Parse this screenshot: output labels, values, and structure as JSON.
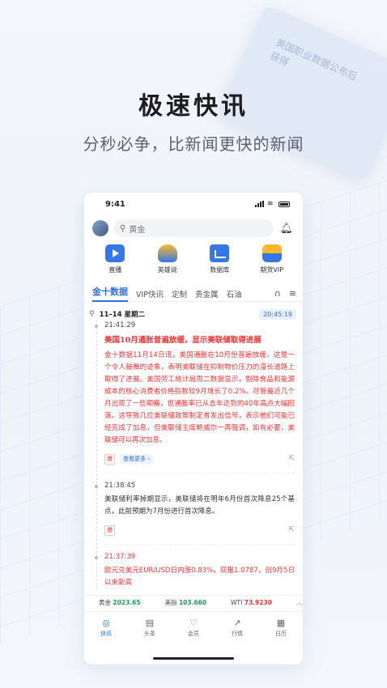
{
  "promo": {
    "title": "极速快讯",
    "subtitle": "分秒必争，比新闻更快的新闻",
    "bg_card_text": [
      "美国职业数据公布后",
      "获得"
    ]
  },
  "status": {
    "time": "9:41"
  },
  "search": {
    "placeholder": "黄金"
  },
  "quick": [
    {
      "label": "直播",
      "icon": "video-icon"
    },
    {
      "label": "英雄说",
      "icon": "hero-icon"
    },
    {
      "label": "数据库",
      "icon": "database-icon"
    },
    {
      "label": "期货VIP",
      "icon": "vip-icon"
    }
  ],
  "tabs": [
    "金十数据",
    "VIP快讯",
    "定制",
    "贵金属",
    "石油"
  ],
  "date": {
    "text": "11–14 星期二",
    "clock": "20:45:19"
  },
  "feed": [
    {
      "time": "21:41:29",
      "headline": "美国10月通胀普遍放缓，显示美联储取得进展",
      "body": "金十数据11月14日讯，美国通胀在10月份普遍放缓，这是一个令人鼓舞的迹象，表明美联储在抑制物价压力的漫长道路上取得了进展。美国劳工统计局周二数据显示，剔除食品和能源成本的核心消费者价格指数较9月增长了0.2%。尽管最近几个月出现了一些颠簸，但通胀率已从去年达到的40年高点大幅回落。这导致几位美联储政策制定者发出信号，表示他们可能已经完成了加息，但美联储主席鲍威尔一再强调，如有必要，美联储可以再次加息。",
      "tag": "爆",
      "more": "查看更多 ›"
    },
    {
      "time": "21:38:45",
      "body": "美联储利率掉期显示，美联储将在明年6月份首次降息25个基点，此前预期为7月份进行首次降息。",
      "tag": "爆"
    },
    {
      "time": "21:37:39",
      "body": "欧元兑美元EUR/USD日内涨0.83%，现报1.0787，创9月5日以来新高"
    }
  ],
  "ticker": [
    {
      "name": "黄金",
      "value": "2023.65",
      "color": "#18a058"
    },
    {
      "name": "美指",
      "value": "103.660",
      "color": "#18a058"
    },
    {
      "name": "WTI",
      "value": "73.9230",
      "color": "#e33"
    }
  ],
  "nav": [
    {
      "label": "快讯",
      "icon": "newsflash-icon",
      "glyph": "◎",
      "active": true
    },
    {
      "label": "头条",
      "icon": "headlines-icon",
      "glyph": "▤",
      "active": false
    },
    {
      "label": "会员",
      "icon": "member-icon",
      "glyph": "♡",
      "active": false
    },
    {
      "label": "行情",
      "icon": "market-icon",
      "glyph": "↗",
      "active": false
    },
    {
      "label": "日历",
      "icon": "calendar-icon",
      "glyph": "▦",
      "active": false
    }
  ]
}
